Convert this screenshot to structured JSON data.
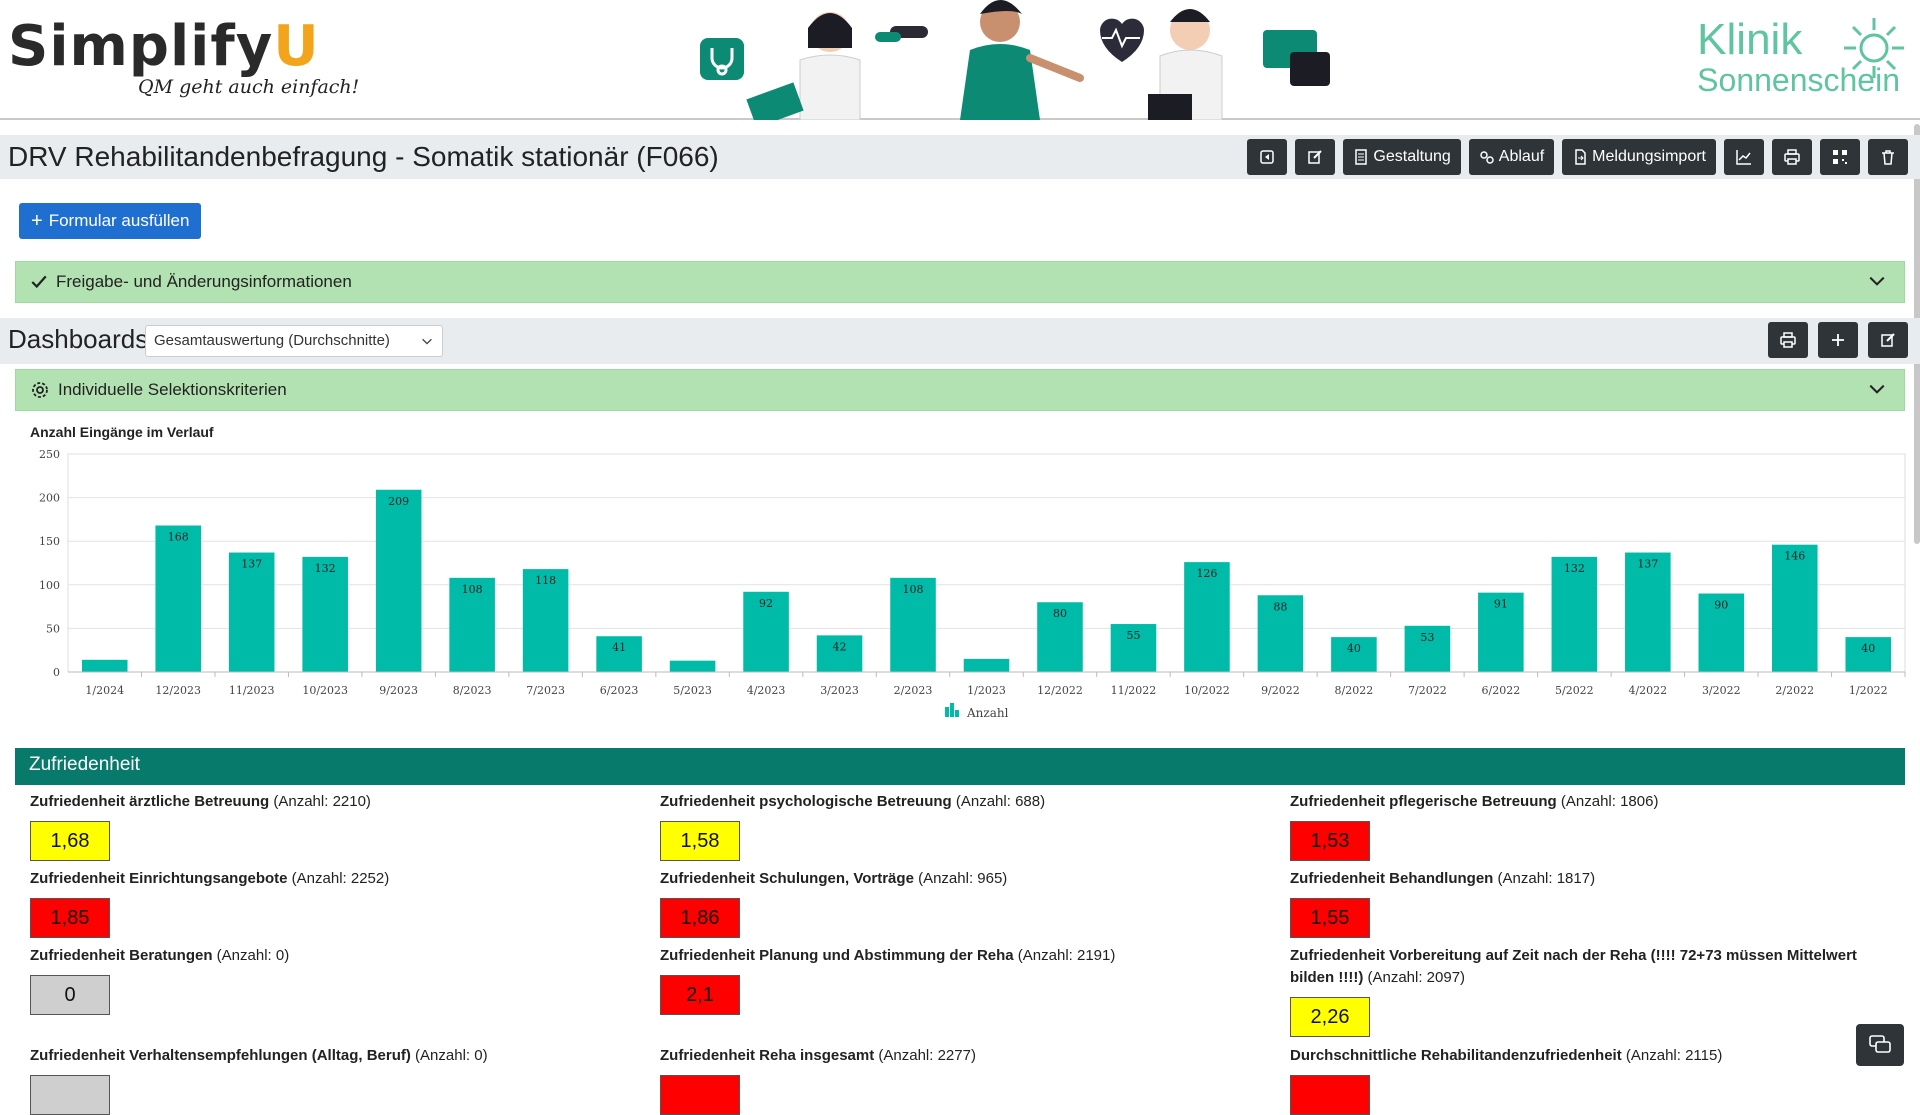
{
  "brand": {
    "logo_main": "Simplify",
    "logo_u": "U",
    "logo_tagline": "QM geht auch einfach!",
    "klinik_line1": "Klinik",
    "klinik_line2": "Sonnenschein"
  },
  "titlebar": {
    "title": "DRV Rehabilitandenbefragung - Somatik stationär (F066)",
    "buttons": {
      "back": "back-icon",
      "edit": "edit-icon",
      "gestaltung": "Gestaltung",
      "ablauf": "Ablauf",
      "meldungsimport": "Meldungsimport",
      "stats": "chart-icon",
      "print": "print-icon",
      "qr": "qr-icon",
      "delete": "trash-icon"
    }
  },
  "actions": {
    "fill_form": "Formular ausfüllen"
  },
  "release_info": {
    "label": "Freigabe- und Änderungsinformationen"
  },
  "dashboards": {
    "title": "Dashboards",
    "selected": "Gesamtauswertung (Durchschnitte)"
  },
  "selection": {
    "label": "Individuelle Selektionskriterien"
  },
  "chart_data": {
    "type": "bar",
    "title": "Anzahl Eingänge im Verlauf",
    "categories": [
      "1/2024",
      "12/2023",
      "11/2023",
      "10/2023",
      "9/2023",
      "8/2023",
      "7/2023",
      "6/2023",
      "5/2023",
      "4/2023",
      "3/2023",
      "2/2023",
      "1/2023",
      "12/2022",
      "11/2022",
      "10/2022",
      "9/2022",
      "8/2022",
      "7/2022",
      "6/2022",
      "5/2022",
      "4/2022",
      "3/2022",
      "2/2022",
      "1/2022"
    ],
    "values": [
      14,
      168,
      137,
      132,
      209,
      108,
      118,
      41,
      13,
      92,
      42,
      108,
      15,
      80,
      55,
      126,
      88,
      40,
      53,
      91,
      132,
      137,
      90,
      146,
      40
    ],
    "labels": [
      "",
      "168",
      "137",
      "132",
      "209",
      "108",
      "118",
      "41",
      "",
      "92",
      "42",
      "108",
      "",
      "80",
      "55",
      "126",
      "88",
      "40",
      "53",
      "91",
      "132",
      "137",
      "90",
      "146",
      "40"
    ],
    "yticks": [
      0,
      50,
      100,
      150,
      200,
      250
    ],
    "ylim": [
      0,
      250
    ],
    "legend": "Anzahl",
    "color": "#00bba7",
    "grid": true,
    "legend_position": "bottom"
  },
  "satisfaction": {
    "title": "Zufriedenheit",
    "colors": {
      "yellow": "#ffff00",
      "red": "#ff0000",
      "gray": "#cfcfcf"
    },
    "items": [
      {
        "label": "Zufriedenheit ärztliche Betreuung",
        "count": " (Anzahl: 2210)",
        "value": "1,68",
        "color": "yellow"
      },
      {
        "label": "Zufriedenheit psychologische Betreuung",
        "count": " (Anzahl: 688)",
        "value": "1,58",
        "color": "yellow"
      },
      {
        "label": "Zufriedenheit pflegerische Betreuung",
        "count": " (Anzahl: 1806)",
        "value": "1,53",
        "color": "red"
      },
      {
        "label": "Zufriedenheit Einrichtungsangebote",
        "count": " (Anzahl: 2252)",
        "value": "1,85",
        "color": "red"
      },
      {
        "label": "Zufriedenheit Schulungen, Vorträge",
        "count": " (Anzahl: 965)",
        "value": "1,86",
        "color": "red"
      },
      {
        "label": "Zufriedenheit Behandlungen",
        "count": " (Anzahl: 1817)",
        "value": "1,55",
        "color": "red"
      },
      {
        "label": "Zufriedenheit Beratungen",
        "count": " (Anzahl: 0)",
        "value": "0",
        "color": "gray"
      },
      {
        "label": "Zufriedenheit Planung und Abstimmung der Reha",
        "count": " (Anzahl: 2191)",
        "value": "2,1",
        "color": "red"
      },
      {
        "label": "Zufriedenheit Vorbereitung auf Zeit nach der Reha (!!!! 72+73 müssen Mittelwert bilden !!!!)",
        "count": " (Anzahl: 2097)",
        "value": "2,26",
        "color": "yellow"
      },
      {
        "label": "Zufriedenheit Verhaltensempfehlungen (Alltag, Beruf)",
        "count": " (Anzahl: 0)",
        "value": "",
        "color": "gray"
      },
      {
        "label": "Zufriedenheit Reha insgesamt",
        "count": " (Anzahl: 2277)",
        "value": "",
        "color": "red"
      },
      {
        "label": "Durchschnittliche Rehabilitandenzufriedenheit",
        "count": " (Anzahl: 2115)",
        "value": "",
        "color": "red"
      }
    ]
  }
}
